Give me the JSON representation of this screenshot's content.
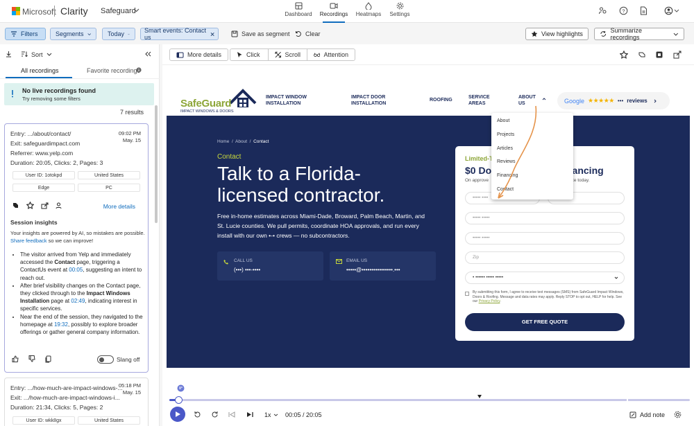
{
  "topbar": {
    "brand": "Microsoft",
    "product": "Clarity",
    "project": "Safeguard",
    "nav": [
      {
        "label": "Dashboard",
        "icon": "dashboard-icon"
      },
      {
        "label": "Recordings",
        "icon": "recordings-icon",
        "active": true
      },
      {
        "label": "Heatmaps",
        "icon": "heatmaps-icon"
      },
      {
        "label": "Settings",
        "icon": "settings-icon"
      }
    ],
    "right_icons": [
      "share-users-icon",
      "help-icon",
      "document-icon",
      "account-icon"
    ]
  },
  "filterbar": {
    "filters": "Filters",
    "segments": "Segments",
    "date": "Today",
    "smart_event": "Smart events: Contact us",
    "save_segment": "Save as segment",
    "clear": "Clear",
    "view_highlights": "View highlights",
    "summarize": "Summarize recordings"
  },
  "left": {
    "sort": "Sort",
    "tab_all": "All recordings",
    "tab_fav": "Favorite recordings",
    "notice_title": "No live recordings found",
    "notice_sub": "Try removing some filters",
    "results": "7 results",
    "card1": {
      "entry_label": "Entry:",
      "entry": ".../about/contact/",
      "exit_label": "Exit:",
      "exit": "safeguardimpact.com",
      "referrer_label": "Referrer:",
      "referrer": "www.yelp.com",
      "duration_label": "Duration:",
      "duration": "20:05",
      "clicks_label": "Clicks:",
      "clicks": "2",
      "pages_label": "Pages:",
      "pages": "3",
      "time": "09:02 PM",
      "date": "May. 15",
      "user_id": "User ID: 1otokpd",
      "country": "United States",
      "browser": "Edge",
      "device": "PC",
      "more_details": "More details",
      "insights_title": "Session insights",
      "ai_note": "Your insights are powered by AI, so mistakes are possible.",
      "share_feedback": "Share feedback",
      "feedback_rest": " so we can improve!",
      "bullets": [
        {
          "parts": [
            {
              "t": "The visitor arrived from Yelp and immediately accessed the "
            },
            {
              "t": "Contact",
              "b": true
            },
            {
              "t": " page, triggering a ContactUs event at "
            },
            {
              "t": "00:05",
              "link": true
            },
            {
              "t": ", suggesting an intent to reach out."
            }
          ]
        },
        {
          "parts": [
            {
              "t": "After brief visibility changes on the Contact page, they clicked through to the "
            },
            {
              "t": "Impact Windows Installation",
              "b": true
            },
            {
              "t": " page at "
            },
            {
              "t": "02:49",
              "link": true
            },
            {
              "t": ", indicating interest in specific services."
            }
          ]
        },
        {
          "parts": [
            {
              "t": "Near the end of the session, they navigated to the homepage at "
            },
            {
              "t": "19:32",
              "link": true
            },
            {
              "t": ", possibly to explore broader offerings or gather general company information."
            }
          ]
        }
      ],
      "slang_label": "Slang off"
    },
    "card2": {
      "entry_label": "Entry:",
      "entry": ".../how-much-are-impact-windows-...",
      "exit_label": "Exit:",
      "exit": ".../how-much-are-impact-windows-i...",
      "duration_label": "Duration:",
      "duration": "21:34",
      "clicks_label": "Clicks:",
      "clicks": "5",
      "pages_label": "Pages:",
      "pages": "2",
      "time": "05:18 PM",
      "date": "May. 15",
      "user_id": "User ID: wkk8gx",
      "country": "United States"
    }
  },
  "player_toolbar": {
    "more_details": "More details",
    "click": "Click",
    "scroll": "Scroll",
    "attention": "Attention"
  },
  "site": {
    "brand_main": "SafeGuard",
    "brand_sub": "IMPACT WINDOWS & DOORS",
    "nav": [
      {
        "line1": "IMPACT WINDOW",
        "line2": "INSTALLATION"
      },
      {
        "line1": "IMPACT DOOR",
        "line2": "INSTALLATION"
      },
      {
        "line1": "ROOFING",
        "line2": ""
      },
      {
        "line1": "SERVICE",
        "line2": "AREAS"
      },
      {
        "line1": "ABOUT",
        "line2": "US"
      }
    ],
    "google": "Google",
    "stars": "★★★★★",
    "reviews_count": "•••",
    "reviews": "reviews",
    "dropdown": [
      "About",
      "Projects",
      "Articles",
      "Reviews",
      "Financing",
      "Contact"
    ],
    "breadcrumb": [
      "Home",
      "About",
      "Contact"
    ],
    "kicker": "Contact",
    "title": "Talk to a Florida-licensed contractor.",
    "body": "Free in-home estimates across Miami-Dade, Broward, Palm Beach, Martin, and St. Lucie counties. We pull permits, coordinate HOA approvals, and run every install with our own •-• crews — no subcontractors.",
    "call_label": "CALL US",
    "call_value": "(•••) •••-••••",
    "email_label": "EMAIL US",
    "email_value": "•••••@••••••••••••••••.•••",
    "form_kicker": "Limited-T",
    "form_title_a": "$0 Dow",
    "form_title_b": "nancing",
    "form_sub_a": "On approve",
    "form_sub_b": "mate today.",
    "fields": [
      "••••• ••••",
      "••••• •••••",
      "••••• •••••",
      "Zip",
      "• •••••• ••••• •••••"
    ],
    "consent": "By submitting this form, I agree to receive text messages (SMS) from SafeGuard Impact Windows, Doors & Roofing. Message and data rates may apply. Reply STOP to opt out, HELP for help. See our ",
    "privacy": "Privacy Policy",
    "cta": "GET FREE QUOTE"
  },
  "player": {
    "progress": 0.018,
    "speed": "1x",
    "time": "00:05 / 20:05",
    "add_note": "Add note"
  },
  "colors": {
    "accent": "#0f6cbd",
    "filters_bg": "#c7def5",
    "site_navy": "#1b2a5a",
    "site_green": "#c8d83b",
    "notice_bg": "#ddf2ef"
  }
}
